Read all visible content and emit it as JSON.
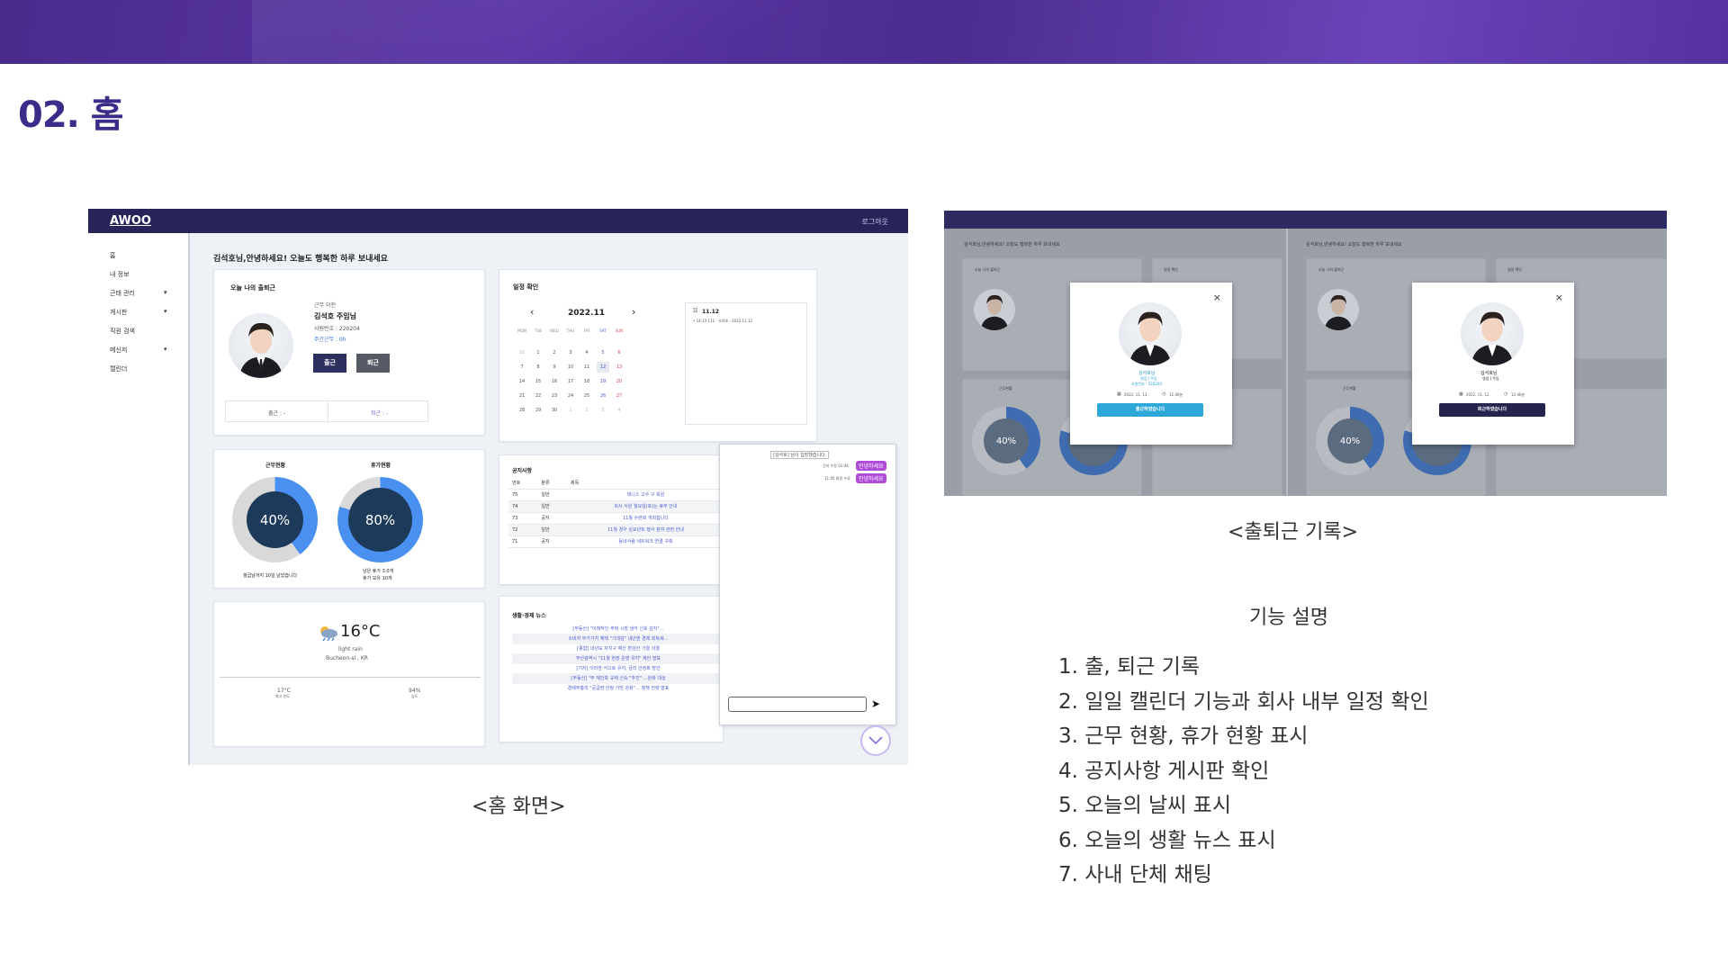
{
  "page": {
    "section_title": "02. 홈"
  },
  "home_screen": {
    "logo": "AWOO",
    "logout": "로그아웃",
    "sidebar": [
      {
        "label": "홈",
        "arrow": ""
      },
      {
        "label": "내 정보",
        "arrow": ""
      },
      {
        "label": "근태 관리",
        "arrow": "▾"
      },
      {
        "label": "게시판",
        "arrow": "▾"
      },
      {
        "label": "직원 검색",
        "arrow": ""
      },
      {
        "label": "메신저",
        "arrow": "▾"
      },
      {
        "label": "캘린더",
        "arrow": ""
      }
    ],
    "greeting": "김석호님,안녕하세요! 오늘도 행복한 하루 보내세요",
    "attendance": {
      "title": "오늘 나의 출퇴근",
      "status": "근무 이전",
      "name": "김석호 주임님",
      "emp_no": "사원번호 : 220204",
      "weekly": "주간근무 : 0h",
      "clock_in_label": "출근",
      "clock_out_label": "퇴근",
      "in_time": "출근 : -",
      "out_time": "퇴근 : -",
      "in_btn_color": "#2d2f5e",
      "out_btn_color": "#555a66"
    },
    "calendar": {
      "title": "일정 확인",
      "month": "2022.11",
      "prev": "‹",
      "next": "›",
      "weekdays": [
        "MON",
        "TUE",
        "WED",
        "THU",
        "FRI",
        "SAT",
        "SUN"
      ],
      "weeks": [
        [
          "31",
          "1",
          "2",
          "3",
          "4",
          "5",
          "6"
        ],
        [
          "7",
          "8",
          "9",
          "10",
          "11",
          "12",
          "13"
        ],
        [
          "14",
          "15",
          "16",
          "17",
          "18",
          "19",
          "20"
        ],
        [
          "21",
          "22",
          "23",
          "24",
          "25",
          "26",
          "27"
        ],
        [
          "28",
          "29",
          "30",
          "1",
          "2",
          "3",
          "4"
        ]
      ],
      "selected": "12",
      "event_date": "11.12",
      "event_text": "• 14:23 111 - 서석호 - 2022.11.12"
    },
    "work": {
      "work_title": "근무현황",
      "work_percent": 40,
      "work_label": "40%",
      "work_caption": "월급날까지 10일 남았습니다",
      "leave_title": "휴가현황",
      "leave_percent": 80,
      "leave_label": "80%",
      "leave_caption_1": "남은 휴가 3.0개",
      "leave_caption_2": "휴가 보유 10개",
      "grey": "#d9d9d9",
      "blue": "#4a90f0",
      "navy": "#1e3a5a"
    },
    "weather": {
      "temp": "16°C",
      "desc": "light rain",
      "location": "Bucheon-si , KR",
      "max": "17°C",
      "max_label": "최고 온도",
      "humidity": "94%",
      "humidity_label": "습도",
      "icon": "rain-cloud-icon"
    },
    "notice": {
      "title": "공지사항",
      "headers": [
        "번호",
        "분류",
        "제목"
      ],
      "rows": [
        [
          "75",
          "일반",
          "테니스 고수 구 회원"
        ],
        [
          "74",
          "일반",
          "회사 사원 월요일(토)는 휴무 안내"
        ],
        [
          "73",
          "공지",
          "11월 수련회 개최합니다"
        ],
        [
          "72",
          "일반",
          "11월 경우 심요년트 행사 참여 관련 안내"
        ],
        [
          "71",
          "공지",
          "동네사람 네트워크 연결 구축"
        ]
      ]
    },
    "news": {
      "title": "생활·경제 뉴스",
      "items": [
        "[부동산] \"이례적인 주택 시장 냉각 신호 감지\"…",
        "소비자 부가가치 혜택 \"기대감\" 내년엔 경제 회복세…",
        "[종합] 내년도 자치구 예산 편성안 가결 의결",
        "부산광역시 \"11월 현장 운영 유지\" 제안 발표",
        "[기자] 이러한 식으로 유지, 금리 안정화 방안",
        "[부동산] \"부 재건축 규제 신속 \"추진\" …완화 대상",
        "경제부총리 \"공급망 안정 기반 강화\"… 정책 전략 발표"
      ]
    },
    "chat": {
      "header": "[김석호] 님이 입장했습니다.",
      "msg1_meta": "건지 수정 01:44",
      "msg1": "안녕하세요",
      "msg2_meta": "11:05 회정 수료",
      "msg2": "안녕하세요",
      "send": "➤"
    }
  },
  "commute_screen": {
    "greeting": "김석호님,안녕하세요! 오늘도 행복한 하루 보내세요",
    "attendance_title": "오늘 나의 출퇴근",
    "calendar_title": "일정 확인",
    "work_title": "근무현황",
    "notice_title": "공지사항",
    "work_label": "40%",
    "leave_label": "80%",
    "modal_left": {
      "name": "김석호님",
      "role": "영업 | 주임",
      "emp": "사원번호 : 220204",
      "date": "2022. 11. 13.",
      "time": "12:46분",
      "button": "출근하였습니다",
      "button_color": "#2ea8d8"
    },
    "modal_right": {
      "name": "김석호님",
      "role": "영업 | 주임",
      "date": "2022. 11. 12.",
      "time": "12:46분",
      "button": "퇴근하였습니다",
      "button_color": "#24244f"
    }
  },
  "captions": {
    "home": "<홈 화면>",
    "commute": "<출퇴근 기록>"
  },
  "features": {
    "title": "기능 설명",
    "items": [
      "1. 출, 퇴근 기록",
      "2. 일일 캘린더 기능과 회사 내부 일정 확인",
      "3. 근무 현황, 휴가 현황 표시",
      "4. 공지사항 게시판 확인",
      "5. 오늘의 날씨 표시",
      "6. 오늘의 생활 뉴스 표시",
      "7. 사내 단체 채팅"
    ]
  }
}
